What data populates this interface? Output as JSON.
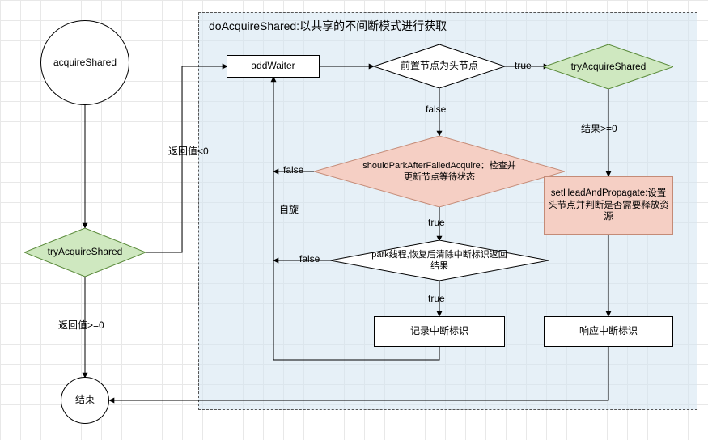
{
  "container": {
    "title": "doAcquireShared:以共享的不间断模式进行获取"
  },
  "nodes": {
    "start": "acquireShared",
    "tryAcq1": "tryAcquireShared",
    "end": "结束",
    "addWaiter": "addWaiter",
    "predHead": "前置节点为头节点",
    "tryAcq2": "tryAcquireShared",
    "shouldPark": "shouldParkAfterFailedAcquire：检查并更新节点等待状态",
    "setHead": "setHeadAndPropagate:设置头节点并判断是否需要释放资源",
    "park": "park线程,恢复后清除中断标识返回结果",
    "record": "记录中断标识",
    "respond": "响应中断标识"
  },
  "edges": {
    "retLt0": "返回值<0",
    "retGe0": "返回值>=0",
    "true": "true",
    "false": "false",
    "spin": "自旋",
    "resGe0": "结果>=0"
  }
}
